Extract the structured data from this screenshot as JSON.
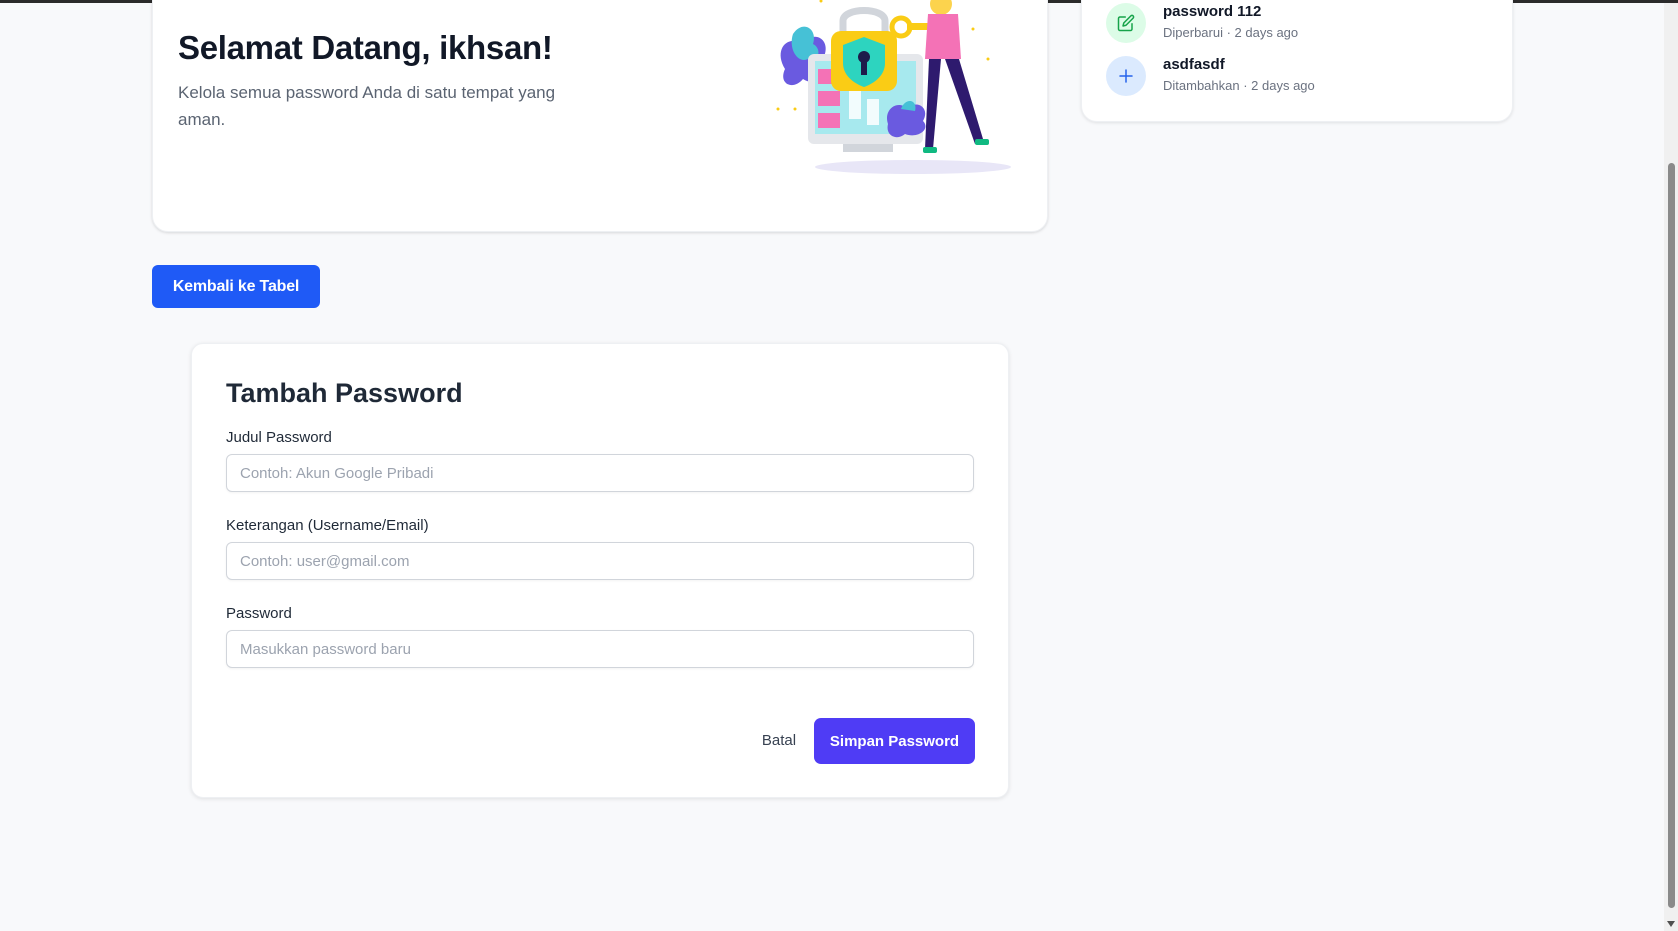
{
  "welcome": {
    "title": "Selamat Datang, ikhsan!",
    "subtitle": "Kelola semua password Anda di satu tempat yang aman."
  },
  "activity": {
    "items": [
      {
        "title": "password 112",
        "meta": "Diperbarui · 2 days ago",
        "icon": "edit-icon",
        "color": "#22c55e"
      },
      {
        "title": "asdfasdf",
        "meta": "Ditambahkan · 2 days ago",
        "icon": "plus-icon",
        "color": "#3b82f6"
      }
    ]
  },
  "nav": {
    "back_label": "Kembali ke Tabel"
  },
  "form": {
    "title": "Tambah Password",
    "fields": [
      {
        "label": "Judul Password",
        "value": "",
        "placeholder": "Contoh: Akun Google Pribadi"
      },
      {
        "label": "Keterangan (Username/Email)",
        "value": "",
        "placeholder": "Contoh: user@gmail.com"
      },
      {
        "label": "Password",
        "value": "",
        "placeholder": "Masukkan password baru"
      }
    ],
    "cancel_label": "Batal",
    "save_label": "Simpan Password"
  },
  "colors": {
    "primary_blue": "#1f5af6",
    "save_indigo": "#4f3cf5",
    "page_background": "#f8f9fb"
  }
}
